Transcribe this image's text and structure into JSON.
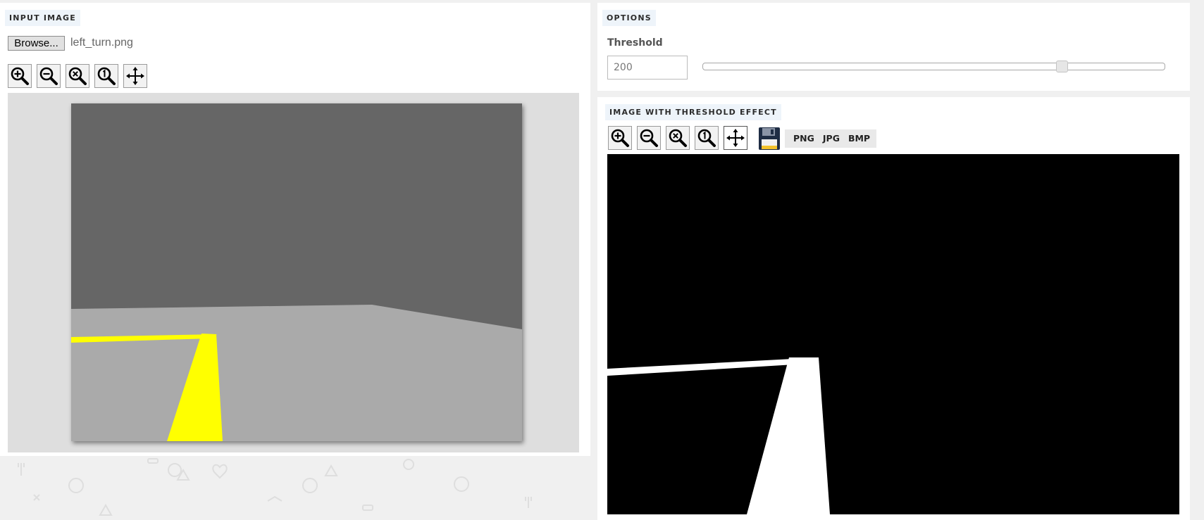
{
  "input_panel": {
    "title": "INPUT IMAGE",
    "browse_label": "Browse...",
    "file_name": "left_turn.png"
  },
  "zoom_toolbar": [
    {
      "name": "zoom-in-icon",
      "active": false
    },
    {
      "name": "zoom-out-icon",
      "active": false
    },
    {
      "name": "zoom-reset-icon",
      "active": false
    },
    {
      "name": "zoom-actual-size-icon",
      "active": false
    },
    {
      "name": "move-icon",
      "active": false
    }
  ],
  "output_toolbar": [
    {
      "name": "zoom-in-icon",
      "active": false
    },
    {
      "name": "zoom-out-icon",
      "active": false
    },
    {
      "name": "zoom-reset-icon",
      "active": false
    },
    {
      "name": "zoom-actual-size-icon",
      "active": false
    },
    {
      "name": "move-icon",
      "active": true
    }
  ],
  "options_panel": {
    "title": "OPTIONS",
    "threshold_label": "Threshold",
    "threshold_value": "200",
    "slider": {
      "min": 0,
      "max": 255,
      "value": 200
    }
  },
  "output_panel": {
    "title": "IMAGE WITH THRESHOLD EFFECT",
    "save_icon": "floppy-disk-icon",
    "formats": [
      "PNG",
      "JPG",
      "BMP"
    ]
  },
  "colors": {
    "background": "#f0f0f0",
    "panel": "#ffffff",
    "title_badge": "#eef4fa",
    "sky": "#666666",
    "floor": "#aaaaaa",
    "lane_line": "#ffff00",
    "threshold_dark": "#000000",
    "threshold_light": "#ffffff"
  }
}
